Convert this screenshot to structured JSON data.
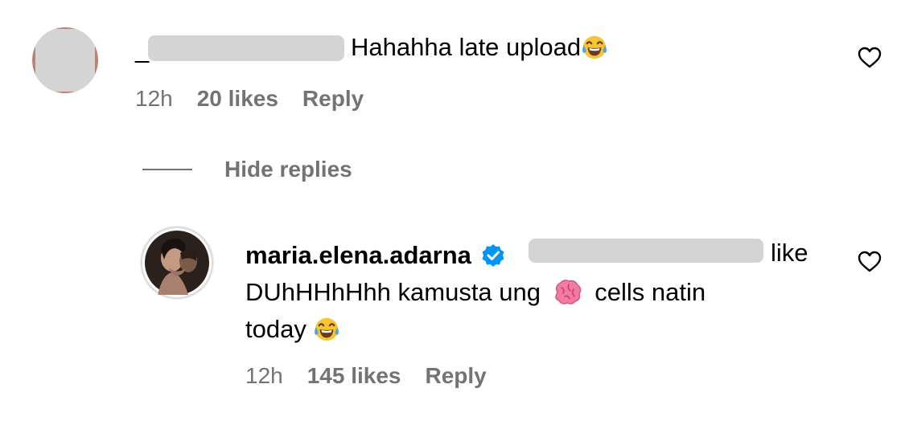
{
  "comment1": {
    "username_prefix": "_",
    "text": "Hahahha late upload",
    "emoji": "face-with-tears-of-joy",
    "time": "12h",
    "likes": "20 likes",
    "reply": "Reply"
  },
  "thread": {
    "hide_replies": "Hide replies"
  },
  "comment2": {
    "username": "maria.elena.adarna",
    "verified": true,
    "line1_tail": "like",
    "line2_before_emoji": "DUhHHhHhh kamusta ung",
    "line2_emoji": "brain",
    "line2_after_emoji": "cells natin",
    "line3": "today",
    "line3_emoji": "face-with-tears-of-joy",
    "time": "12h",
    "likes": "145 likes",
    "reply": "Reply"
  },
  "colors": {
    "meta_gray": "#737373",
    "verified_blue": "#0095f6",
    "redaction_gray": "#d4d4d4"
  }
}
